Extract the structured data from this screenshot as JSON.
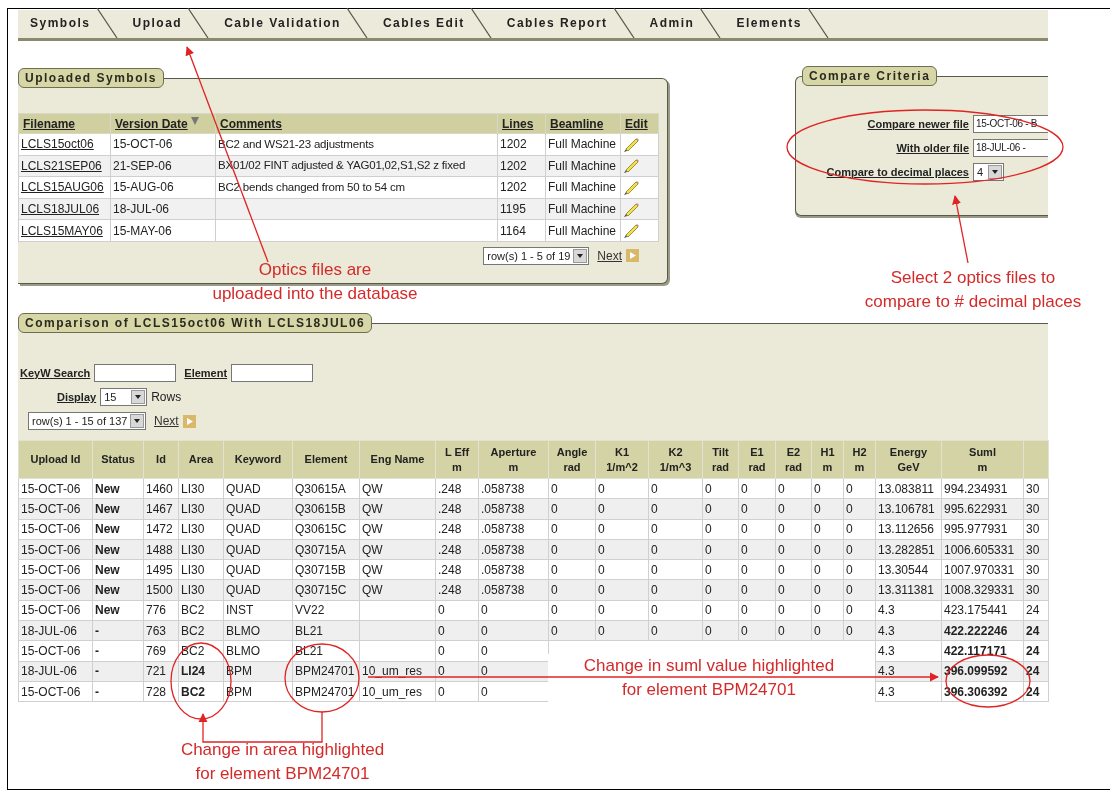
{
  "tabs": [
    {
      "label": "Symbols",
      "selected": false
    },
    {
      "label": "Upload",
      "selected": false
    },
    {
      "label": "Cable Validation",
      "selected": false
    },
    {
      "label": "Cables Edit",
      "selected": false
    },
    {
      "label": "Cables Report",
      "selected": false
    },
    {
      "label": "Admin",
      "selected": false
    },
    {
      "label": "Elements",
      "selected": false
    }
  ],
  "uploaded_symbols": {
    "title": "Uploaded Symbols",
    "columns": [
      {
        "label": "Filename",
        "sorted": false
      },
      {
        "label": "Version Date",
        "sorted": true
      },
      {
        "label": "Comments",
        "sorted": false
      },
      {
        "label": "Lines",
        "sorted": false
      },
      {
        "label": "Beamline",
        "sorted": false
      },
      {
        "label": "Edit",
        "sorted": false
      }
    ],
    "rows": [
      {
        "filename": "LCLS15oct06",
        "version_date": "15-OCT-06",
        "comments": "BC2 and WS21-23 adjustments",
        "lines": "1202",
        "beamline": "Full Machine"
      },
      {
        "filename": "LCLS21SEP06",
        "version_date": "21-SEP-06",
        "comments": "BX01/02 FINT adjusted & YAG01,02,S1,S2 z fixed",
        "lines": "1202",
        "beamline": "Full Machine"
      },
      {
        "filename": "LCLS15AUG06",
        "version_date": "15-AUG-06",
        "comments": "BC2 bends changed from 50 to 54 cm",
        "lines": "1202",
        "beamline": "Full Machine"
      },
      {
        "filename": "LCLS18JUL06",
        "version_date": "18-JUL-06",
        "lines": "1195",
        "beamline": "Full Machine"
      },
      {
        "filename": "LCLS15MAY06",
        "version_date": "15-MAY-06",
        "lines": "1164",
        "beamline": "Full Machine"
      }
    ],
    "pagination": {
      "range": "row(s) 1 - 5 of 19",
      "next": "Next"
    }
  },
  "compare_criteria": {
    "title": "Compare Criteria",
    "fields": [
      {
        "label": "Compare newer file",
        "value": "15-OCT-06 - B",
        "kind": "text"
      },
      {
        "label": "With older file",
        "value": "18-JUL-06 -",
        "kind": "text"
      },
      {
        "label": "Compare to decimal places",
        "value": "4",
        "kind": "select"
      }
    ]
  },
  "comparison": {
    "title": "Comparison of LCLS15oct06 With LCLS18JUL06",
    "keyword_search": {
      "label": "KeyW Search"
    },
    "element_filter": {
      "label": "Element"
    },
    "display": {
      "label": "Display",
      "value": "15",
      "suffix": "Rows"
    },
    "pagination": {
      "range": "row(s) 1 - 15 of 137",
      "next": "Next"
    },
    "columns": [
      {
        "label": "Upload Id"
      },
      {
        "label": "Status"
      },
      {
        "label": "Id"
      },
      {
        "label": "Area"
      },
      {
        "label": "Keyword"
      },
      {
        "label": "Element"
      },
      {
        "label": "Eng Name"
      },
      {
        "label": "L Eff",
        "unit": "m"
      },
      {
        "label": "Aperture",
        "unit": "m"
      },
      {
        "label": "Angle",
        "unit": "rad"
      },
      {
        "label": "K1",
        "unit": "1/m^2"
      },
      {
        "label": "K2",
        "unit": "1/m^3"
      },
      {
        "label": "Tilt",
        "unit": "rad"
      },
      {
        "label": "E1",
        "unit": "rad"
      },
      {
        "label": "E2",
        "unit": "rad"
      },
      {
        "label": "H1",
        "unit": "m"
      },
      {
        "label": "H2",
        "unit": "m"
      },
      {
        "label": "Energy",
        "unit": "GeV"
      },
      {
        "label": "Suml",
        "unit": "m"
      }
    ],
    "rows": [
      {
        "cells": [
          "15-OCT-06",
          "New",
          "1460",
          "LI30",
          "QUAD",
          "Q30615A",
          "QW",
          ".248",
          ".058738",
          "0",
          "0",
          "0",
          "0",
          "0",
          "0",
          "0",
          "0",
          "13.083811",
          "994.234931",
          "30"
        ],
        "area_changed": false,
        "suml_changed": false
      },
      {
        "cells": [
          "15-OCT-06",
          "New",
          "1467",
          "LI30",
          "QUAD",
          "Q30615B",
          "QW",
          ".248",
          ".058738",
          "0",
          "0",
          "0",
          "0",
          "0",
          "0",
          "0",
          "0",
          "13.106781",
          "995.622931",
          "30"
        ],
        "area_changed": false,
        "suml_changed": false
      },
      {
        "cells": [
          "15-OCT-06",
          "New",
          "1472",
          "LI30",
          "QUAD",
          "Q30615C",
          "QW",
          ".248",
          ".058738",
          "0",
          "0",
          "0",
          "0",
          "0",
          "0",
          "0",
          "0",
          "13.112656",
          "995.977931",
          "30"
        ],
        "area_changed": false,
        "suml_changed": false
      },
      {
        "cells": [
          "15-OCT-06",
          "New",
          "1488",
          "LI30",
          "QUAD",
          "Q30715A",
          "QW",
          ".248",
          ".058738",
          "0",
          "0",
          "0",
          "0",
          "0",
          "0",
          "0",
          "0",
          "13.282851",
          "1006.605331",
          "30"
        ],
        "area_changed": false,
        "suml_changed": false
      },
      {
        "cells": [
          "15-OCT-06",
          "New",
          "1495",
          "LI30",
          "QUAD",
          "Q30715B",
          "QW",
          ".248",
          ".058738",
          "0",
          "0",
          "0",
          "0",
          "0",
          "0",
          "0",
          "0",
          "13.30544",
          "1007.970331",
          "30"
        ],
        "area_changed": false,
        "suml_changed": false
      },
      {
        "cells": [
          "15-OCT-06",
          "New",
          "1500",
          "LI30",
          "QUAD",
          "Q30715C",
          "QW",
          ".248",
          ".058738",
          "0",
          "0",
          "0",
          "0",
          "0",
          "0",
          "0",
          "0",
          "13.311381",
          "1008.329331",
          "30"
        ],
        "area_changed": false,
        "suml_changed": false
      },
      {
        "cells": [
          "15-OCT-06",
          "New",
          "776",
          "BC2",
          "INST",
          "VV22",
          null,
          "0",
          "0",
          "0",
          "0",
          "0",
          "0",
          "0",
          "0",
          "0",
          "0",
          "4.3",
          "423.175441",
          "24"
        ],
        "area_changed": false,
        "suml_changed": false
      },
      {
        "cells": [
          "18-JUL-06",
          "-",
          "763",
          "BC2",
          "BLMO",
          "BL21",
          null,
          "0",
          "0",
          "0",
          "0",
          "0",
          "0",
          "0",
          "0",
          "0",
          "0",
          "4.3",
          "422.222246",
          "24"
        ],
        "area_changed": false,
        "suml_changed": true
      },
      {
        "cells": [
          "15-OCT-06",
          "-",
          "769",
          "BC2",
          "BLMO",
          "BL21",
          null,
          "0",
          "0",
          null,
          null,
          null,
          null,
          null,
          null,
          null,
          null,
          "4.3",
          "422.117171",
          "24"
        ],
        "area_changed": false,
        "suml_changed": true
      },
      {
        "cells": [
          "18-JUL-06",
          "-",
          "721",
          "LI24",
          "BPM",
          "BPM24701",
          "10_um_res",
          "0",
          "0",
          null,
          null,
          null,
          null,
          null,
          null,
          null,
          null,
          "4.3",
          "396.099592",
          "24"
        ],
        "area_changed": true,
        "suml_changed": true
      },
      {
        "cells": [
          "15-OCT-06",
          "-",
          "728",
          "BC2",
          "BPM",
          "BPM24701",
          "10_um_res",
          "0",
          "0",
          null,
          null,
          null,
          null,
          null,
          null,
          null,
          null,
          "4.3",
          "396.306392",
          "24"
        ],
        "area_changed": true,
        "suml_changed": true
      }
    ]
  },
  "annotations": [
    {
      "lines": [
        "Optics files are",
        "uploaded into the database"
      ]
    },
    {
      "lines": [
        "Select 2 optics files to",
        "compare to # decimal places"
      ]
    },
    {
      "lines": [
        "Change in suml value highlighted",
        "for element BPM24701"
      ]
    },
    {
      "lines": [
        "Change in area highlighted",
        "for element BPM24701"
      ]
    }
  ]
}
